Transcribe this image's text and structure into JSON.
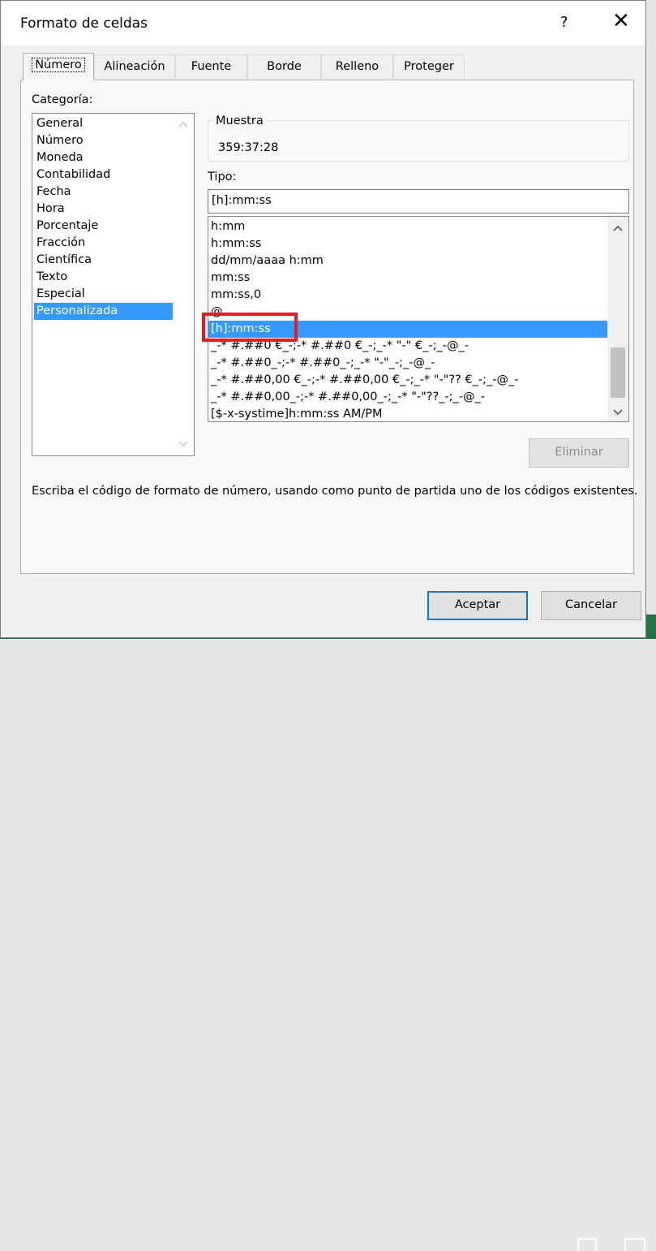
{
  "dialog": {
    "title": "Formato de celdas",
    "help_label": "?",
    "close_label": "✕"
  },
  "tabs": [
    {
      "label": "Número",
      "active": true
    },
    {
      "label": "Alineación",
      "active": false
    },
    {
      "label": "Fuente",
      "active": false
    },
    {
      "label": "Borde",
      "active": false
    },
    {
      "label": "Relleno",
      "active": false
    },
    {
      "label": "Proteger",
      "active": false
    }
  ],
  "category": {
    "label": "Categoría:",
    "items": [
      "General",
      "Número",
      "Moneda",
      "Contabilidad",
      "Fecha",
      "Hora",
      "Porcentaje",
      "Fracción",
      "Científica",
      "Texto",
      "Especial",
      "Personalizada"
    ],
    "selected": "Personalizada"
  },
  "sample": {
    "label": "Muestra",
    "value": "359:37:28"
  },
  "type": {
    "label": "Tipo:",
    "value": "[h]:mm:ss",
    "items": [
      "h:mm",
      "h:mm:ss",
      "dd/mm/aaaa h:mm",
      "mm:ss",
      "mm:ss,0",
      "@",
      "[h]:mm:ss",
      "_-* #.##0 €_-;-* #.##0 €_-;_-* \"-\" €_-;_-@_-",
      "_-* #.##0_-;-* #.##0_-;_-* \"-\"_-;_-@_-",
      "_-* #.##0,00 €_-;-* #.##0,00 €_-;_-* \"-\"?? €_-;_-@_-",
      "_-* #.##0,00_-;-* #.##0,00_-;_-* \"-\"??_-;_-@_-",
      "[$-x-systime]h:mm:ss AM/PM"
    ],
    "selected": "[h]:mm:ss"
  },
  "buttons": {
    "delete": "Eliminar",
    "accept": "Aceptar",
    "cancel": "Cancelar"
  },
  "description": "Escriba el código de formato de número, usando como punto de partida uno de los códigos existentes.",
  "colors": {
    "selection": "#3399ff",
    "highlight_box": "#e51c23",
    "excel_green": "#217346",
    "primary_border": "#0078d7"
  },
  "icons": [
    "help-icon",
    "close-icon",
    "scroll-up-icon",
    "scroll-down-icon"
  ]
}
